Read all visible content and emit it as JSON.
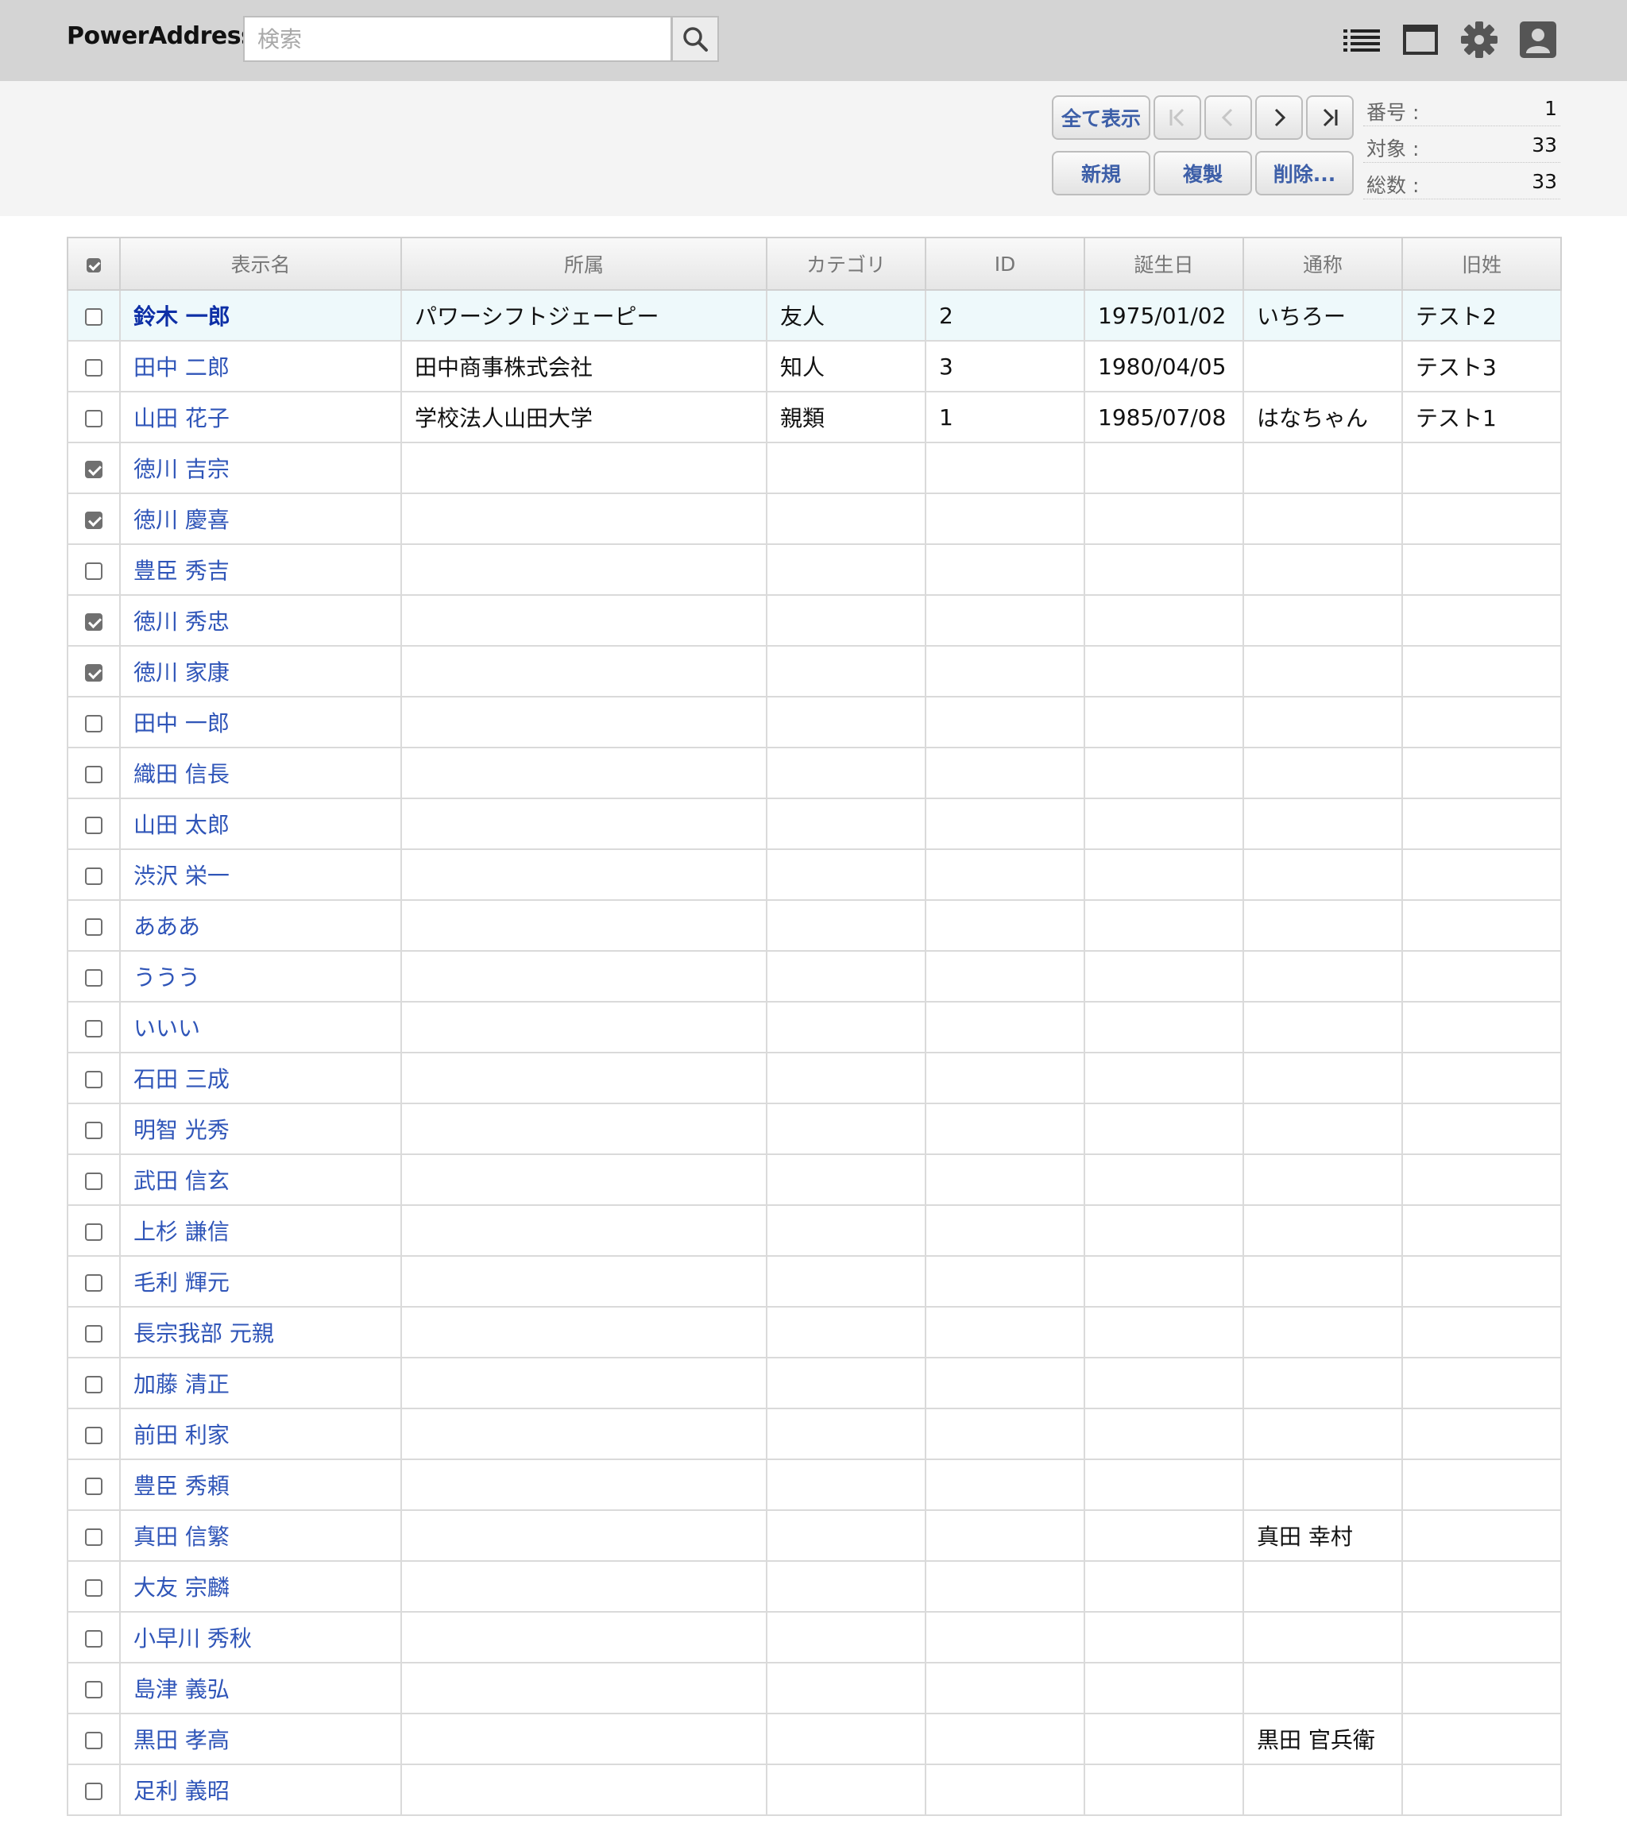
{
  "app": {
    "title": "PowerAddress"
  },
  "search": {
    "placeholder": "検索",
    "value": ""
  },
  "header_icons": [
    "list-view-icon",
    "window-icon",
    "gear-icon",
    "user-icon"
  ],
  "toolbar": {
    "show_all": "全て表示",
    "new": "新規",
    "duplicate": "複製",
    "delete": "削除...",
    "first_disabled": true,
    "prev_disabled": true
  },
  "stats": {
    "number_label": "番号 :",
    "number_value": "1",
    "target_label": "対象 :",
    "target_value": "33",
    "total_label": "総数 :",
    "total_value": "33"
  },
  "table": {
    "headers": [
      "表示名",
      "所属",
      "カテゴリ",
      "ID",
      "誕生日",
      "通称",
      "旧姓"
    ],
    "header_checkbox_checked": true,
    "rows": [
      {
        "checked": false,
        "selected": true,
        "name": "鈴木 一郎",
        "org": "パワーシフトジェーピー",
        "category": "友人",
        "id": "2",
        "birthday": "1975/01/02",
        "nickname": "いちろー",
        "maiden": "テスト2"
      },
      {
        "checked": false,
        "selected": false,
        "name": "田中 二郎",
        "org": "田中商事株式会社",
        "category": "知人",
        "id": "3",
        "birthday": "1980/04/05",
        "nickname": "",
        "maiden": "テスト3"
      },
      {
        "checked": false,
        "selected": false,
        "name": "山田 花子",
        "org": "学校法人山田大学",
        "category": "親類",
        "id": "1",
        "birthday": "1985/07/08",
        "nickname": "はなちゃん",
        "maiden": "テスト1"
      },
      {
        "checked": true,
        "selected": false,
        "name": "徳川 吉宗",
        "org": "",
        "category": "",
        "id": "",
        "birthday": "",
        "nickname": "",
        "maiden": ""
      },
      {
        "checked": true,
        "selected": false,
        "name": "徳川 慶喜",
        "org": "",
        "category": "",
        "id": "",
        "birthday": "",
        "nickname": "",
        "maiden": ""
      },
      {
        "checked": false,
        "selected": false,
        "name": "豊臣 秀吉",
        "org": "",
        "category": "",
        "id": "",
        "birthday": "",
        "nickname": "",
        "maiden": ""
      },
      {
        "checked": true,
        "selected": false,
        "name": "徳川 秀忠",
        "org": "",
        "category": "",
        "id": "",
        "birthday": "",
        "nickname": "",
        "maiden": ""
      },
      {
        "checked": true,
        "selected": false,
        "name": "徳川 家康",
        "org": "",
        "category": "",
        "id": "",
        "birthday": "",
        "nickname": "",
        "maiden": ""
      },
      {
        "checked": false,
        "selected": false,
        "name": "田中 一郎",
        "org": "",
        "category": "",
        "id": "",
        "birthday": "",
        "nickname": "",
        "maiden": ""
      },
      {
        "checked": false,
        "selected": false,
        "name": "織田 信長",
        "org": "",
        "category": "",
        "id": "",
        "birthday": "",
        "nickname": "",
        "maiden": ""
      },
      {
        "checked": false,
        "selected": false,
        "name": "山田 太郎",
        "org": "",
        "category": "",
        "id": "",
        "birthday": "",
        "nickname": "",
        "maiden": ""
      },
      {
        "checked": false,
        "selected": false,
        "name": "渋沢 栄一",
        "org": "",
        "category": "",
        "id": "",
        "birthday": "",
        "nickname": "",
        "maiden": ""
      },
      {
        "checked": false,
        "selected": false,
        "name": "あああ",
        "org": "",
        "category": "",
        "id": "",
        "birthday": "",
        "nickname": "",
        "maiden": ""
      },
      {
        "checked": false,
        "selected": false,
        "name": "ううう",
        "org": "",
        "category": "",
        "id": "",
        "birthday": "",
        "nickname": "",
        "maiden": ""
      },
      {
        "checked": false,
        "selected": false,
        "name": "いいい",
        "org": "",
        "category": "",
        "id": "",
        "birthday": "",
        "nickname": "",
        "maiden": ""
      },
      {
        "checked": false,
        "selected": false,
        "name": "石田 三成",
        "org": "",
        "category": "",
        "id": "",
        "birthday": "",
        "nickname": "",
        "maiden": ""
      },
      {
        "checked": false,
        "selected": false,
        "name": "明智 光秀",
        "org": "",
        "category": "",
        "id": "",
        "birthday": "",
        "nickname": "",
        "maiden": ""
      },
      {
        "checked": false,
        "selected": false,
        "name": "武田 信玄",
        "org": "",
        "category": "",
        "id": "",
        "birthday": "",
        "nickname": "",
        "maiden": ""
      },
      {
        "checked": false,
        "selected": false,
        "name": "上杉 謙信",
        "org": "",
        "category": "",
        "id": "",
        "birthday": "",
        "nickname": "",
        "maiden": ""
      },
      {
        "checked": false,
        "selected": false,
        "name": "毛利 輝元",
        "org": "",
        "category": "",
        "id": "",
        "birthday": "",
        "nickname": "",
        "maiden": ""
      },
      {
        "checked": false,
        "selected": false,
        "name": "長宗我部 元親",
        "org": "",
        "category": "",
        "id": "",
        "birthday": "",
        "nickname": "",
        "maiden": ""
      },
      {
        "checked": false,
        "selected": false,
        "name": "加藤 清正",
        "org": "",
        "category": "",
        "id": "",
        "birthday": "",
        "nickname": "",
        "maiden": ""
      },
      {
        "checked": false,
        "selected": false,
        "name": "前田 利家",
        "org": "",
        "category": "",
        "id": "",
        "birthday": "",
        "nickname": "",
        "maiden": ""
      },
      {
        "checked": false,
        "selected": false,
        "name": "豊臣 秀頼",
        "org": "",
        "category": "",
        "id": "",
        "birthday": "",
        "nickname": "",
        "maiden": ""
      },
      {
        "checked": false,
        "selected": false,
        "name": "真田 信繁",
        "org": "",
        "category": "",
        "id": "",
        "birthday": "",
        "nickname": "真田 幸村",
        "maiden": ""
      },
      {
        "checked": false,
        "selected": false,
        "name": "大友 宗麟",
        "org": "",
        "category": "",
        "id": "",
        "birthday": "",
        "nickname": "",
        "maiden": ""
      },
      {
        "checked": false,
        "selected": false,
        "name": "小早川 秀秋",
        "org": "",
        "category": "",
        "id": "",
        "birthday": "",
        "nickname": "",
        "maiden": ""
      },
      {
        "checked": false,
        "selected": false,
        "name": "島津 義弘",
        "org": "",
        "category": "",
        "id": "",
        "birthday": "",
        "nickname": "",
        "maiden": ""
      },
      {
        "checked": false,
        "selected": false,
        "name": "黒田 孝高",
        "org": "",
        "category": "",
        "id": "",
        "birthday": "",
        "nickname": "黒田 官兵衛",
        "maiden": ""
      },
      {
        "checked": false,
        "selected": false,
        "name": "足利 義昭",
        "org": "",
        "category": "",
        "id": "",
        "birthday": "",
        "nickname": "",
        "maiden": ""
      }
    ]
  }
}
